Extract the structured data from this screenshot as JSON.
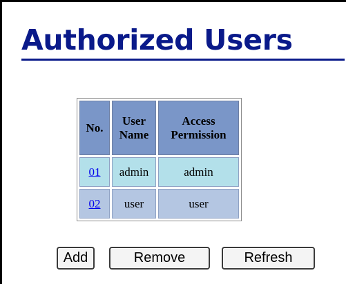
{
  "page": {
    "title": "Authorized Users"
  },
  "table": {
    "headers": {
      "no": "No.",
      "user_name_line1": "User",
      "user_name_line2": "Name",
      "access_line1": "Access",
      "access_line2": "Permission"
    },
    "rows": [
      {
        "no": "01",
        "user_name": "admin",
        "permission": "admin"
      },
      {
        "no": "02",
        "user_name": "user",
        "permission": "user"
      }
    ]
  },
  "buttons": {
    "add": "Add",
    "remove": "Remove",
    "refresh": "Refresh"
  },
  "colors": {
    "title": "#0a1a8a",
    "header_bg": "#7a96c8",
    "row1_bg": "#b3e0ea",
    "row2_bg": "#b4c6e2",
    "link": "#0000ee"
  }
}
